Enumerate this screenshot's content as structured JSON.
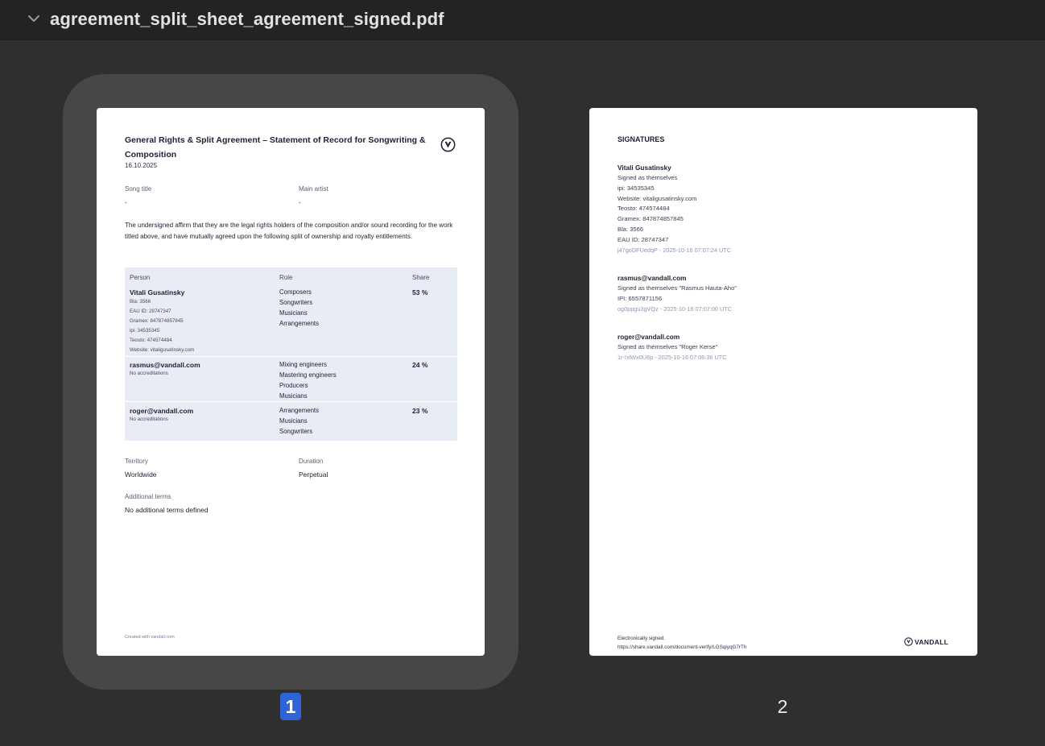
{
  "window": {
    "filename": "agreement_split_sheet_agreement_signed.pdf"
  },
  "thumbnails": [
    {
      "number": "1",
      "selected": true
    },
    {
      "number": "2",
      "selected": false
    }
  ],
  "page1": {
    "title": "General Rights & Split Agreement – Statement of Record for Songwriting & Composition",
    "date": "16.10.2025",
    "song_title_label": "Song title",
    "song_title_value": "-",
    "main_artist_label": "Main artist",
    "main_artist_value": "-",
    "paragraph": "The undersigned affirm that they are the legal rights holders of the composition and/or sound recording for the work titled above, and have mutually agreed upon the following split of ownership and royalty entitlements.",
    "table": {
      "headers": [
        "Person",
        "Role",
        "Share"
      ],
      "rows": [
        {
          "person": "Vitali Gusatinsky",
          "details": [
            "Bla: 3566",
            "EAU ID: 28747347",
            "Gramex: 847874857845",
            "ipi: 34535345",
            "Teosto: 474574484",
            "Website: vitaligusatinsky.com"
          ],
          "roles": [
            "Composers",
            "Songwriters",
            "Musicians",
            "Arrangements"
          ],
          "share": "53 %"
        },
        {
          "person": "rasmus@vandall.com",
          "details": [
            "No accreditations"
          ],
          "roles": [
            "Mixing engineers",
            "Mastering engineers",
            "Producers",
            "Musicians"
          ],
          "share": "24 %"
        },
        {
          "person": "roger@vandall.com",
          "details": [
            "No accreditations"
          ],
          "roles": [
            "Arrangements",
            "Musicians",
            "Songwriters"
          ],
          "share": "23 %"
        }
      ]
    },
    "territory_label": "Territory",
    "territory_value": "Worldwide",
    "duration_label": "Duration",
    "duration_value": "Perpetual",
    "additional_terms_label": "Additional terms",
    "additional_terms_value": "No additional terms defined",
    "footer": "Created with vandall.com"
  },
  "page2": {
    "heading": "SIGNATURES",
    "signatures": [
      {
        "name": "Vitali Gusatinsky",
        "lines": [
          "Signed as themselves",
          "ipi: 34535345",
          "Website: vitaligusatinsky.com",
          "Teosto: 474574484",
          "Gramex: 847874857845",
          "Bla: 3566",
          "EAU ID: 28747347"
        ],
        "hash": "j47goDFUedqP - 2025-10-16 07:07:24 UTC"
      },
      {
        "name": "rasmus@vandall.com",
        "lines": [
          "Signed as themselves \"Rasmus Hauta-Aho\"",
          "IPI: 6557871156"
        ],
        "hash": "og0ppgu3gVQz - 2025-10-16 07:07:00 UTC"
      },
      {
        "name": "roger@vandall.com",
        "lines": [
          "Signed as themselves \"Roger Kerse\""
        ],
        "hash": "1r-IxlWx0U6p - 2025-10-16 07:06:36 UTC"
      }
    ],
    "footer_line1": "Electronically signed.",
    "footer_line2": "https://share.vandall.com/document-verify/LGSqiyqG7rTh",
    "brand": "VANDALL"
  }
}
